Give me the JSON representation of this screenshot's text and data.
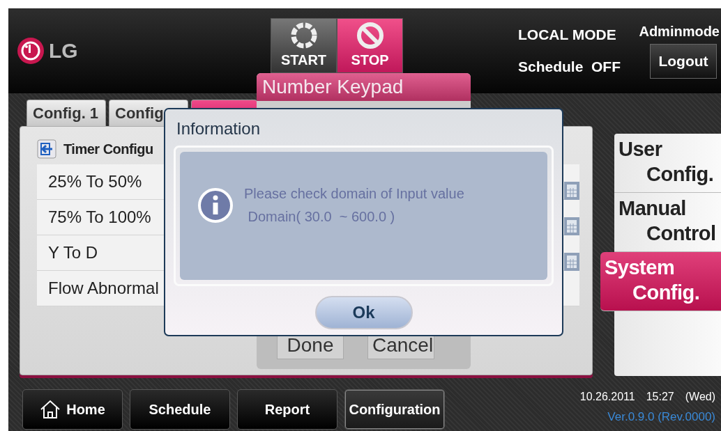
{
  "header": {
    "logo": "LG",
    "run_buttons": [
      {
        "kind": "start",
        "label": "START",
        "selected": false
      },
      {
        "kind": "stop",
        "label": "STOP",
        "selected": true
      }
    ],
    "mode": "LOCAL MODE",
    "schedule": "Schedule  OFF",
    "user": "Adminmode",
    "logout": "Logout"
  },
  "tabs": [
    {
      "label": "Config. 1",
      "selected": false
    },
    {
      "label": "Config",
      "selected": false
    },
    {
      "selected": true
    }
  ],
  "panel": {
    "title": "Timer Configu",
    "rows": [
      {
        "label": "25% To 50%",
        "keypad": true
      },
      {
        "label": "75% To 100%",
        "keypad": true
      },
      {
        "label": "Y To D",
        "keypad": true
      },
      {
        "label": "Flow Abnormal",
        "keypad": false
      }
    ]
  },
  "side_menu": [
    {
      "lines": [
        "User",
        "Config."
      ],
      "selected": false
    },
    {
      "lines": [
        "Manual",
        "Control"
      ],
      "selected": false
    },
    {
      "lines": [
        "System",
        "Config."
      ],
      "selected": true
    }
  ],
  "keypad": {
    "title": "Number Keypad",
    "buttons": [
      "Done",
      "Cancel"
    ]
  },
  "dialog": {
    "title": "Information",
    "message": [
      "Please check domain of Input value",
      " Domain( 30.0  ~ 600.0 )"
    ],
    "button": "Ok"
  },
  "footer": {
    "nav": [
      {
        "kind": "home",
        "label": "Home",
        "selected": false
      },
      {
        "kind": "plain",
        "label": "Schedule",
        "selected": false
      },
      {
        "kind": "plain",
        "label": "Report",
        "selected": false
      },
      {
        "kind": "plain",
        "label": "Configuration",
        "selected": true
      }
    ],
    "date": "10.26.2011",
    "time": "15:27",
    "day": "(Wed)",
    "version": "Ver.0.9.0 (Rev.0000)"
  }
}
